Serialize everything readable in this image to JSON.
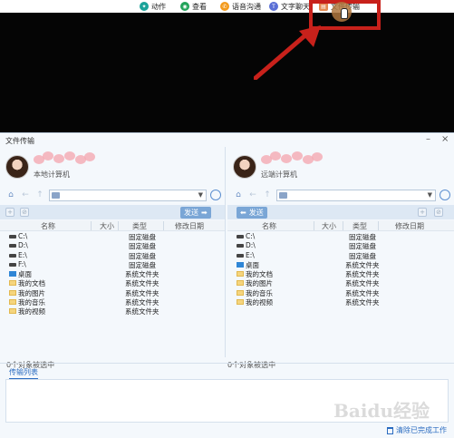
{
  "toolbar": {
    "items": [
      {
        "label": "动作",
        "icon": "action-icon",
        "color": "#1aa39a"
      },
      {
        "label": "查看",
        "icon": "eye-icon",
        "color": "#22a35a"
      },
      {
        "label": "语音沟通",
        "icon": "phone-icon",
        "color": "#f39a1c"
      },
      {
        "label": "文字聊天",
        "icon": "text-icon",
        "color": "#5a6fd6"
      },
      {
        "label": "文件传输",
        "icon": "file-transfer-icon",
        "color": "#e38a50"
      }
    ]
  },
  "window": {
    "title": "文件传输",
    "min": "–",
    "close": "×"
  },
  "left": {
    "pc_label": "本地计算机",
    "send_label": "发送",
    "send_arrow": "➡",
    "status": "0个对象被选中"
  },
  "right": {
    "pc_label": "远端计算机",
    "send_label": "发送",
    "send_arrow": "⬅",
    "status": "0个对象被选中"
  },
  "columns": {
    "name": "名称",
    "size": "大小",
    "type": "类型",
    "date": "修改日期"
  },
  "rows": [
    {
      "name": "C:\\",
      "type": "固定磁盘",
      "kind": "drive"
    },
    {
      "name": "D:\\",
      "type": "固定磁盘",
      "kind": "drive"
    },
    {
      "name": "E:\\",
      "type": "固定磁盘",
      "kind": "drive"
    },
    {
      "name": "F:\\",
      "type": "固定磁盘",
      "kind": "drive"
    },
    {
      "name": "桌面",
      "type": "系统文件夹",
      "kind": "desk"
    },
    {
      "name": "我的文档",
      "type": "系统文件夹",
      "kind": "folder"
    },
    {
      "name": "我的图片",
      "type": "系统文件夹",
      "kind": "folder"
    },
    {
      "name": "我的音乐",
      "type": "系统文件夹",
      "kind": "folder"
    },
    {
      "name": "我的视频",
      "type": "系统文件夹",
      "kind": "folder"
    }
  ],
  "right_rows": [
    {
      "name": "C:\\",
      "type": "固定磁盘",
      "kind": "drive"
    },
    {
      "name": "D:\\",
      "type": "固定磁盘",
      "kind": "drive"
    },
    {
      "name": "E:\\",
      "type": "固定磁盘",
      "kind": "drive"
    },
    {
      "name": "桌面",
      "type": "系统文件夹",
      "kind": "desk"
    },
    {
      "name": "我的文档",
      "type": "系统文件夹",
      "kind": "folder"
    },
    {
      "name": "我的图片",
      "type": "系统文件夹",
      "kind": "folder"
    },
    {
      "name": "我的音乐",
      "type": "系统文件夹",
      "kind": "folder"
    },
    {
      "name": "我的视频",
      "type": "系统文件夹",
      "kind": "folder"
    }
  ],
  "transfer": {
    "tab_label": "传输列表",
    "clear_label": "清除已完成工作"
  },
  "watermark": "Baidu经验"
}
